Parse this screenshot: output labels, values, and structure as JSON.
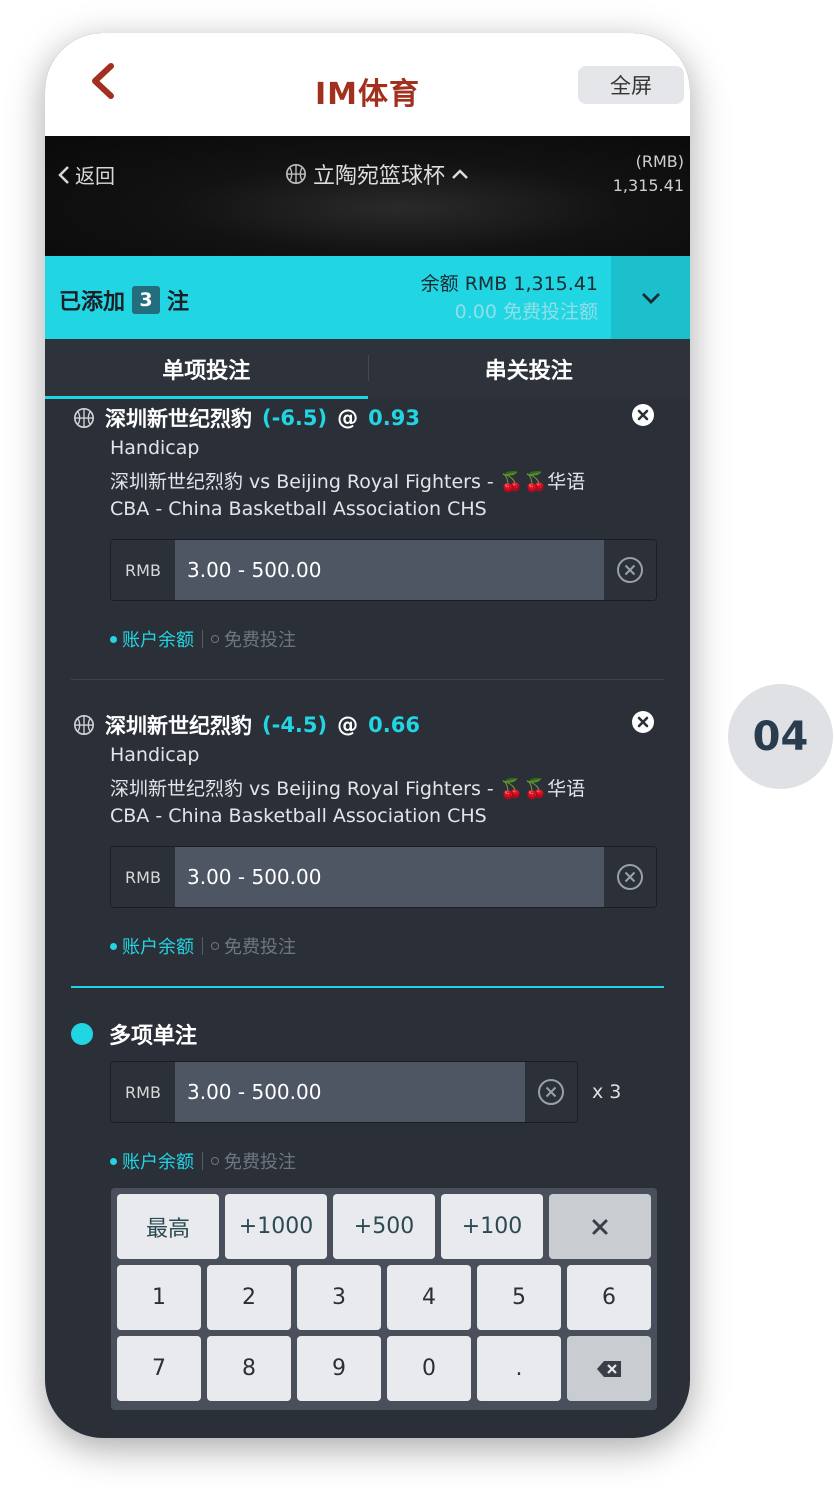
{
  "header": {
    "title": "IM体育",
    "fullscreen_label": "全屏"
  },
  "banner": {
    "back_label": "返回",
    "league_title": "立陶宛篮球杯",
    "currency": "(RMB)",
    "balance": "1,315.41"
  },
  "betslip": {
    "added_prefix": "已添加",
    "count": "3",
    "added_suffix": "注",
    "balance_line": "余额 RMB 1,315.41",
    "free_line": "0.00 免费投注额"
  },
  "tabs": [
    {
      "label": "单项投注",
      "active": true
    },
    {
      "label": "串关投注",
      "active": false
    }
  ],
  "bets": [
    {
      "team": "深圳新世纪烈豹",
      "handicap": "(-6.5)",
      "at": "@",
      "odds": "0.93",
      "market": "Handicap",
      "match": "深圳新世纪烈豹 vs Beijing Royal Fighters - 🍒🍒华语",
      "league": "CBA - China Basketball Association CHS",
      "currency": "RMB",
      "placeholder": "3.00 - 500.00",
      "account_balance": "账户余额",
      "free_bet": "免费投注"
    },
    {
      "team": "深圳新世纪烈豹",
      "handicap": "(-4.5)",
      "at": "@",
      "odds": "0.66",
      "market": "Handicap",
      "match": "深圳新世纪烈豹 vs Beijing Royal Fighters - 🍒🍒华语",
      "league": "CBA - China Basketball Association CHS",
      "currency": "RMB",
      "placeholder": "3.00 - 500.00",
      "account_balance": "账户余额",
      "free_bet": "免费投注"
    }
  ],
  "multi": {
    "title": "多项单注",
    "currency": "RMB",
    "placeholder": "3.00 - 500.00",
    "multiplier": "x 3",
    "account_balance": "账户余额",
    "free_bet": "免费投注"
  },
  "keypad": {
    "top": [
      "最高",
      "+1000",
      "+500",
      "+100"
    ],
    "row1": [
      "1",
      "2",
      "3",
      "4",
      "5",
      "6"
    ],
    "row2": [
      "7",
      "8",
      "9",
      "0",
      "."
    ]
  },
  "step_badge": "04",
  "colors": {
    "accent": "#22d5e3",
    "brand": "#a2301f",
    "panel": "#2b3038"
  }
}
